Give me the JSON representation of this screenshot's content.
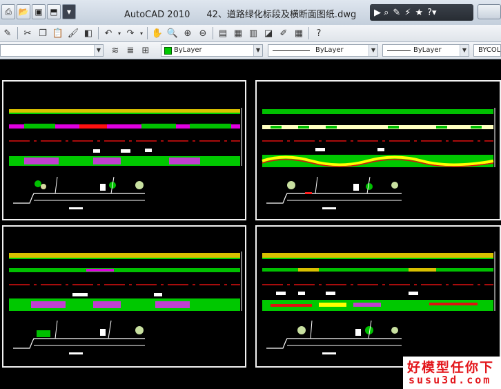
{
  "app": {
    "name": "AutoCAD 2010",
    "file": "42、道路绿化标段及横断面图纸.dwg"
  },
  "layer_props": {
    "color": "ByLayer",
    "linetype": "ByLayer",
    "lineweight": "ByLayer",
    "plot_color": "BYCOLOR",
    "color_swatch": "#00c800"
  },
  "watermark": {
    "title": "好模型任你下",
    "site": "susu3d.com"
  },
  "icons": {
    "quick_access": [
      "print-icon",
      "open-icon",
      "save-icon",
      "undo-icon",
      "dropdown-icon"
    ],
    "toolbar": [
      "pen-icon",
      "cut-icon",
      "copy-icon",
      "paste-icon",
      "match-properties-icon",
      "undo-icon",
      "redo-icon",
      "pan-icon",
      "zoom-realtime-icon",
      "zoom-window-icon",
      "zoom-previous-icon",
      "properties-icon",
      "design-center-icon",
      "tool-palette-icon",
      "sheet-set-icon",
      "markup-icon",
      "calculator-icon",
      "help-icon"
    ],
    "infocenter": [
      "binoculars-icon",
      "wrench-icon",
      "communication-icon",
      "favorites-icon",
      "help-icon"
    ]
  }
}
